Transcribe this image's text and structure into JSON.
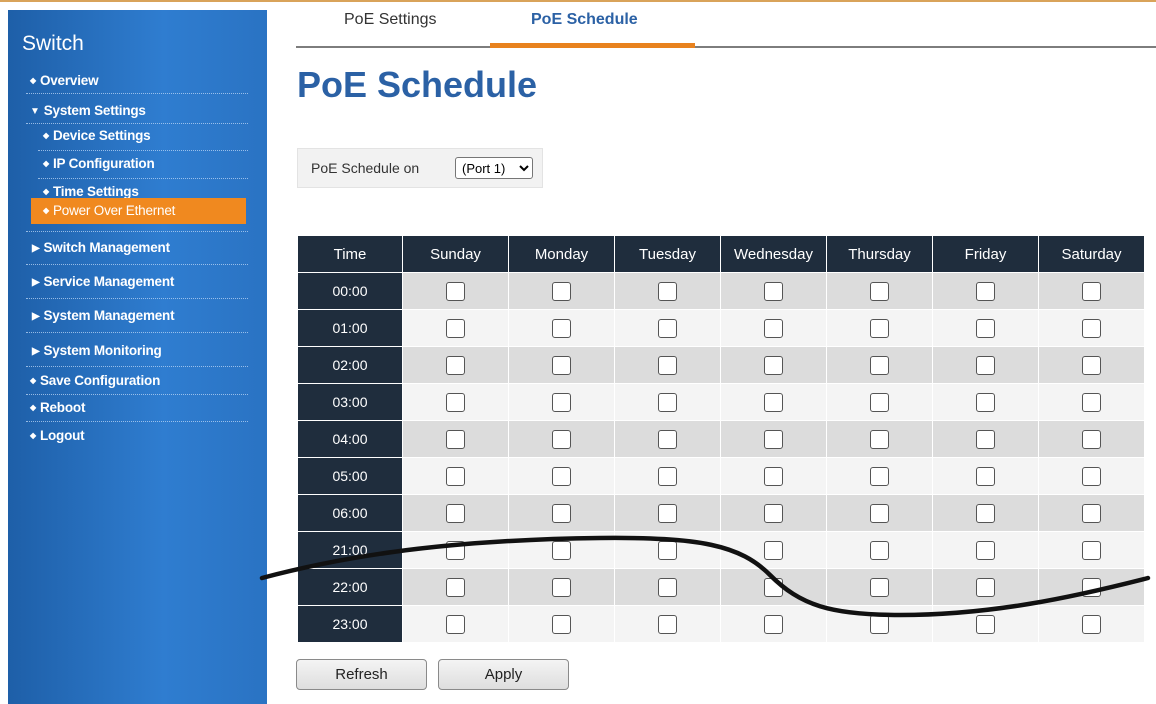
{
  "sidebar": {
    "title": "Switch",
    "items": [
      {
        "label": "Overview",
        "type": "dot"
      },
      {
        "label": "System Settings",
        "type": "expanded"
      },
      {
        "label": "Device Settings",
        "type": "sub"
      },
      {
        "label": "IP Configuration",
        "type": "sub"
      },
      {
        "label": "Time Settings",
        "type": "sub"
      },
      {
        "label": "Power Over Ethernet",
        "type": "sub-active"
      },
      {
        "label": "Switch Management",
        "type": "collapsed"
      },
      {
        "label": "Service Management",
        "type": "collapsed"
      },
      {
        "label": "System Management",
        "type": "collapsed"
      },
      {
        "label": "System Monitoring",
        "type": "collapsed"
      },
      {
        "label": "Save Configuration",
        "type": "dot"
      },
      {
        "label": "Reboot",
        "type": "dot"
      },
      {
        "label": "Logout",
        "type": "dot"
      }
    ]
  },
  "tabs": [
    {
      "label": "PoE Settings",
      "active": false
    },
    {
      "label": "PoE Schedule",
      "active": true
    }
  ],
  "page_title": "PoE Schedule",
  "port_selector": {
    "label": "PoE Schedule on",
    "selected": "(Port 1)"
  },
  "schedule_table": {
    "headers": [
      "Time",
      "Sunday",
      "Monday",
      "Tuesday",
      "Wednesday",
      "Thursday",
      "Friday",
      "Saturday"
    ],
    "rows": [
      "00:00",
      "01:00",
      "02:00",
      "03:00",
      "04:00",
      "05:00",
      "06:00",
      "21:00",
      "22:00",
      "23:00"
    ]
  },
  "buttons": {
    "refresh": "Refresh",
    "apply": "Apply"
  },
  "colors": {
    "sidebar": "#2a73c3",
    "active_item": "#f0891f",
    "title": "#2b61a5",
    "table_header": "#1f2d3d"
  }
}
